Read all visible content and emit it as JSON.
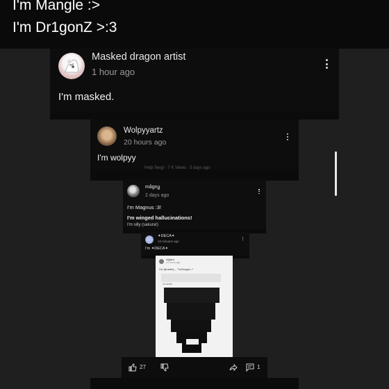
{
  "overlay": {
    "line1": "I'm Mangle :>",
    "line2": "I'm Dr1gonZ >:3"
  },
  "comments": [
    {
      "author": "Masked dragon artist",
      "time": "1 hour ago",
      "text": "I'm masked."
    },
    {
      "author": "Wolpyyartz",
      "time": "20 hours ago",
      "text": "I'm wolpyy",
      "faint": "Help Sergi · 7 K Views · 5 days ago"
    },
    {
      "author": "mågnu͇",
      "time": "2 days ago",
      "text": "I'm Magnus :3!",
      "bold": "I'm winged hallucinations!",
      "faint": "I'm silly (sakura!)"
    },
    {
      "author": "✦DECA✦",
      "time": "16 minutes ago",
      "text": "I'm ✦DECA✦"
    }
  ],
  "nested": {
    "author": "sujaira",
    "time": "14 hours ago",
    "text": "I'm @nailed_.. TrxDragon ⚡",
    "inner": "I'm small"
  },
  "actions": {
    "like_count": "27",
    "reply_count": "1"
  }
}
